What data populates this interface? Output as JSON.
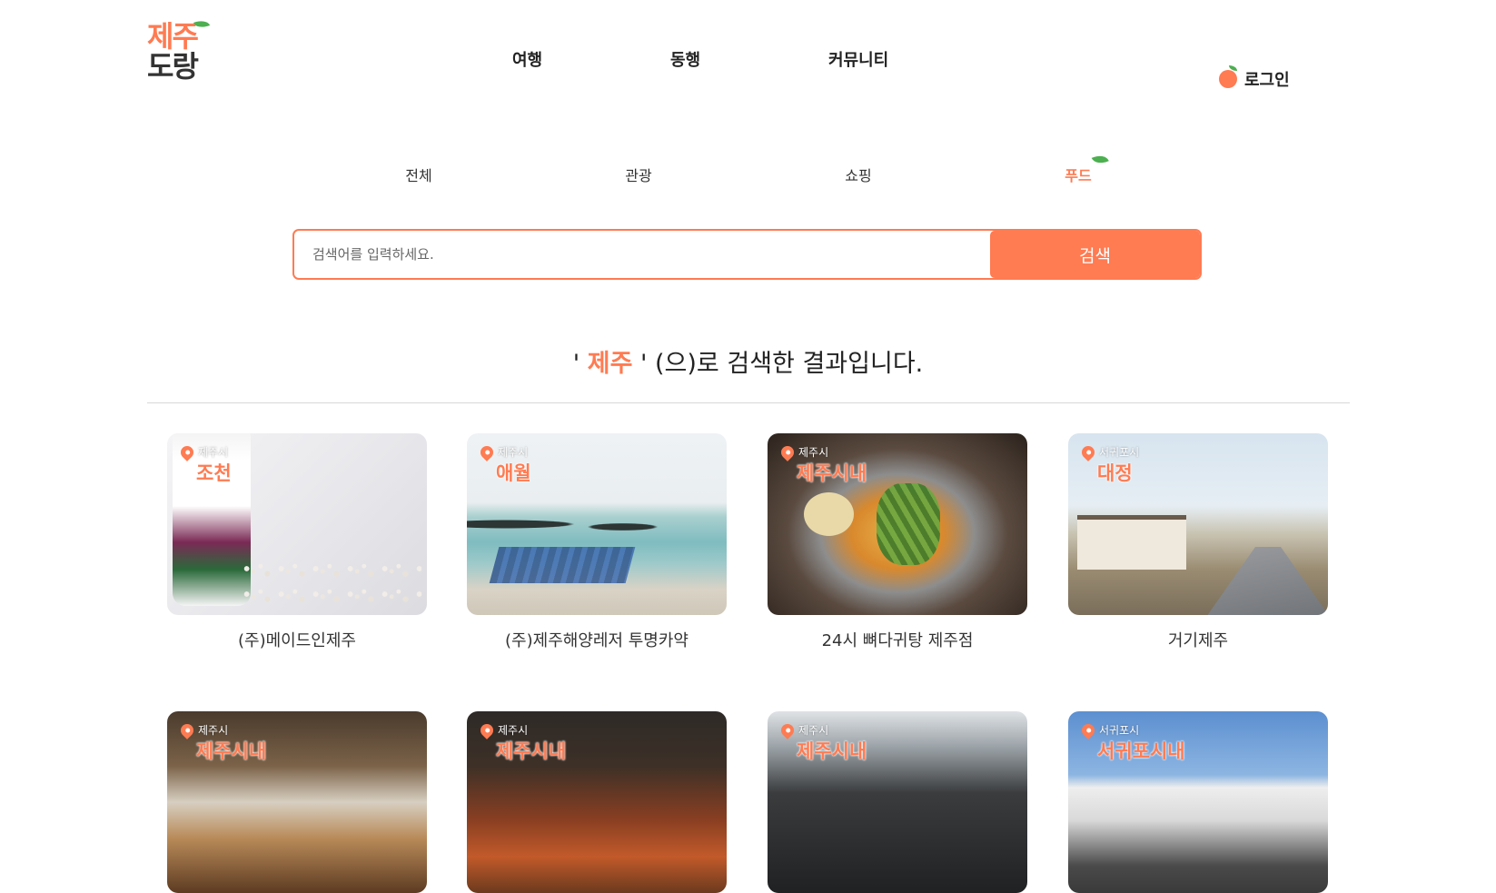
{
  "header": {
    "logo_line1": "제주",
    "logo_line2": "도랑",
    "nav": [
      "여행",
      "동행",
      "커뮤니티"
    ],
    "login_label": "로그인"
  },
  "categories": [
    {
      "label": "전체",
      "active": false
    },
    {
      "label": "관광",
      "active": false
    },
    {
      "label": "쇼핑",
      "active": false
    },
    {
      "label": "푸드",
      "active": true
    }
  ],
  "search": {
    "placeholder": "검색어를 입력하세요.",
    "button_label": "검색"
  },
  "result": {
    "quote_open": "' ",
    "keyword": "제주",
    "quote_close": " ' (으)로 검색한 결과입니다."
  },
  "cards": [
    {
      "region": "제주시",
      "area": "조천",
      "name": "(주)메이드인제주"
    },
    {
      "region": "제주시",
      "area": "애월",
      "name": "(주)제주해양레저 투명카약"
    },
    {
      "region": "제주시",
      "area": "제주시내",
      "name": "24시 뼈다귀탕 제주점"
    },
    {
      "region": "서귀포시",
      "area": "대정",
      "name": "거기제주"
    },
    {
      "region": "제주시",
      "area": "제주시내",
      "name": ""
    },
    {
      "region": "제주시",
      "area": "제주시내",
      "name": ""
    },
    {
      "region": "제주시",
      "area": "제주시내",
      "name": ""
    },
    {
      "region": "서귀포시",
      "area": "서귀포시내",
      "name": ""
    }
  ],
  "colors": {
    "accent": "#ff7b52",
    "leaf": "#4caf50",
    "text": "#222222"
  },
  "icons": {
    "location": "map-pin-icon",
    "login": "tangerine-icon",
    "active_category": "leaf-icon"
  }
}
